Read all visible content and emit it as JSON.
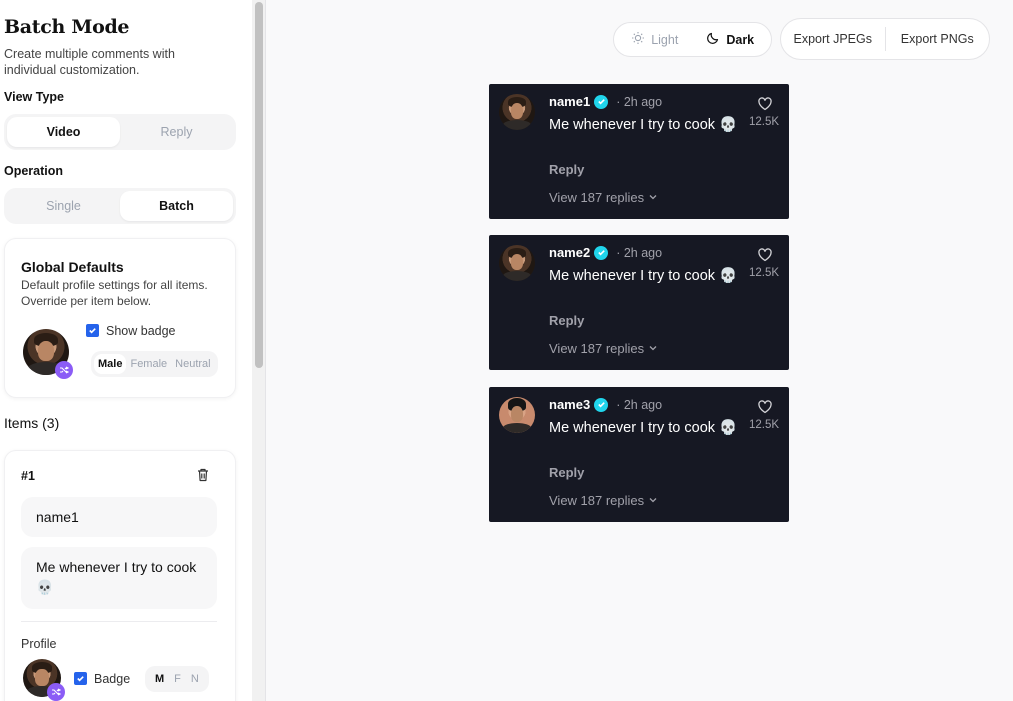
{
  "sidebar": {
    "title": "Batch Mode",
    "subtitle": "Create multiple comments with individual customization.",
    "view_type": {
      "label": "View Type",
      "options": [
        "Video",
        "Reply"
      ],
      "selected": "Video"
    },
    "operation": {
      "label": "Operation",
      "options": [
        "Single",
        "Batch"
      ],
      "selected": "Batch"
    },
    "global_defaults": {
      "title": "Global Defaults",
      "description": "Default profile settings for all items. Override per item below.",
      "show_badge_label": "Show badge",
      "show_badge_checked": true,
      "genders": [
        "Male",
        "Female",
        "Neutral"
      ],
      "gender_selected": "Male"
    },
    "items_title": "Items (3)",
    "item": {
      "number": "#1",
      "name_value": "name1",
      "comment_value": "Me whenever I try to cook 💀",
      "profile_label": "Profile",
      "badge_label": "Badge",
      "badge_checked": true,
      "genders": [
        "M",
        "F",
        "N"
      ],
      "gender_selected": "M"
    }
  },
  "toolbar": {
    "theme_options": [
      "Light",
      "Dark"
    ],
    "theme_selected": "Dark",
    "export_jpegs": "Export JPEGs",
    "export_pngs": "Export PNGs"
  },
  "comments": [
    {
      "name": "name1",
      "time": "· 2h ago",
      "text": "Me whenever I try to cook 💀",
      "reply": "Reply",
      "view_replies": "View 187 replies",
      "likes": "12.5K"
    },
    {
      "name": "name2",
      "time": "· 2h ago",
      "text": "Me whenever I try to cook 💀",
      "reply": "Reply",
      "view_replies": "View 187 replies",
      "likes": "12.5K"
    },
    {
      "name": "name3",
      "time": "· 2h ago",
      "text": "Me whenever I try to cook 💀",
      "reply": "Reply",
      "view_replies": "View 187 replies",
      "likes": "12.5K"
    }
  ],
  "colors": {
    "accent_purple": "#8b5cf6",
    "checkbox_blue": "#2563eb",
    "verified_cyan": "#20d5ec",
    "comment_bg": "#161823"
  }
}
